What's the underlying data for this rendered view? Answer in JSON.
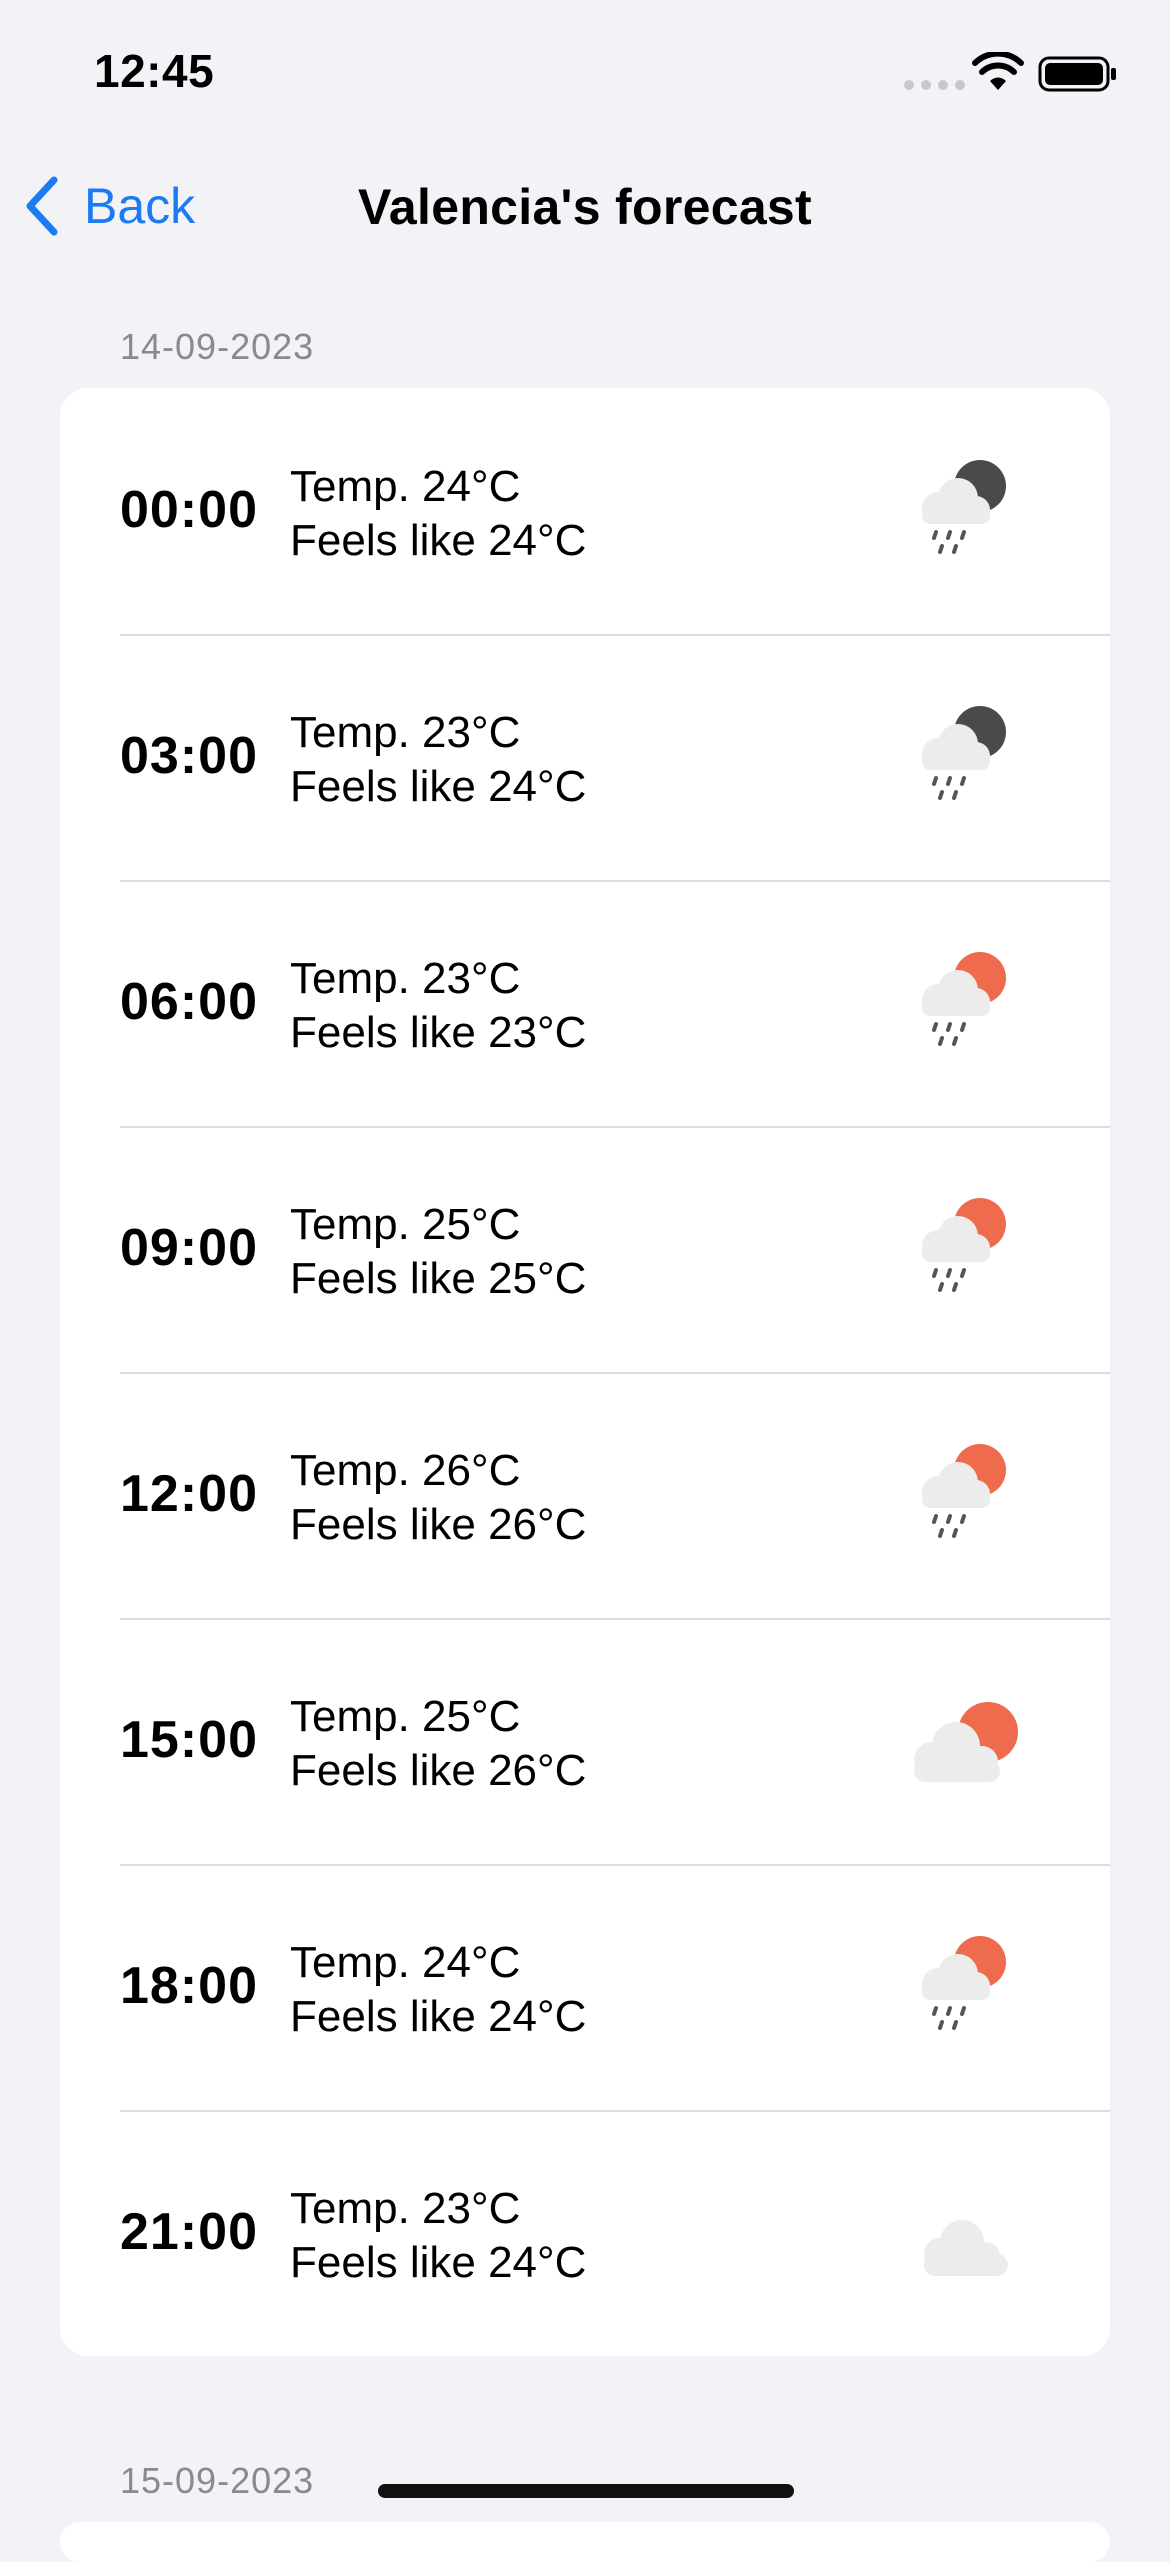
{
  "status_bar": {
    "time": "12:45"
  },
  "nav": {
    "back_label": "Back",
    "title": "Valencia's forecast"
  },
  "sections": [
    {
      "date": "14-09-2023",
      "rows": [
        {
          "time": "00:00",
          "temp": "Temp. 24°C",
          "feels": "Feels like 24°C",
          "icon": "night-rain-icon"
        },
        {
          "time": "03:00",
          "temp": "Temp. 23°C",
          "feels": "Feels like 24°C",
          "icon": "night-rain-icon"
        },
        {
          "time": "06:00",
          "temp": "Temp. 23°C",
          "feels": "Feels like 23°C",
          "icon": "sun-rain-icon"
        },
        {
          "time": "09:00",
          "temp": "Temp. 25°C",
          "feels": "Feels like 25°C",
          "icon": "sun-rain-icon"
        },
        {
          "time": "12:00",
          "temp": "Temp. 26°C",
          "feels": "Feels like 26°C",
          "icon": "sun-rain-icon"
        },
        {
          "time": "15:00",
          "temp": "Temp. 25°C",
          "feels": "Feels like 26°C",
          "icon": "sun-cloud-icon"
        },
        {
          "time": "18:00",
          "temp": "Temp. 24°C",
          "feels": "Feels like 24°C",
          "icon": "sun-rain-icon"
        },
        {
          "time": "21:00",
          "temp": "Temp. 23°C",
          "feels": "Feels like 24°C",
          "icon": "cloud-icon"
        }
      ]
    },
    {
      "date": "15-09-2023"
    }
  ],
  "colors": {
    "accent": "#1a7bf2",
    "sun": "#ee6b4d",
    "moon": "#4a4a4a",
    "cloud": "#ececec"
  }
}
